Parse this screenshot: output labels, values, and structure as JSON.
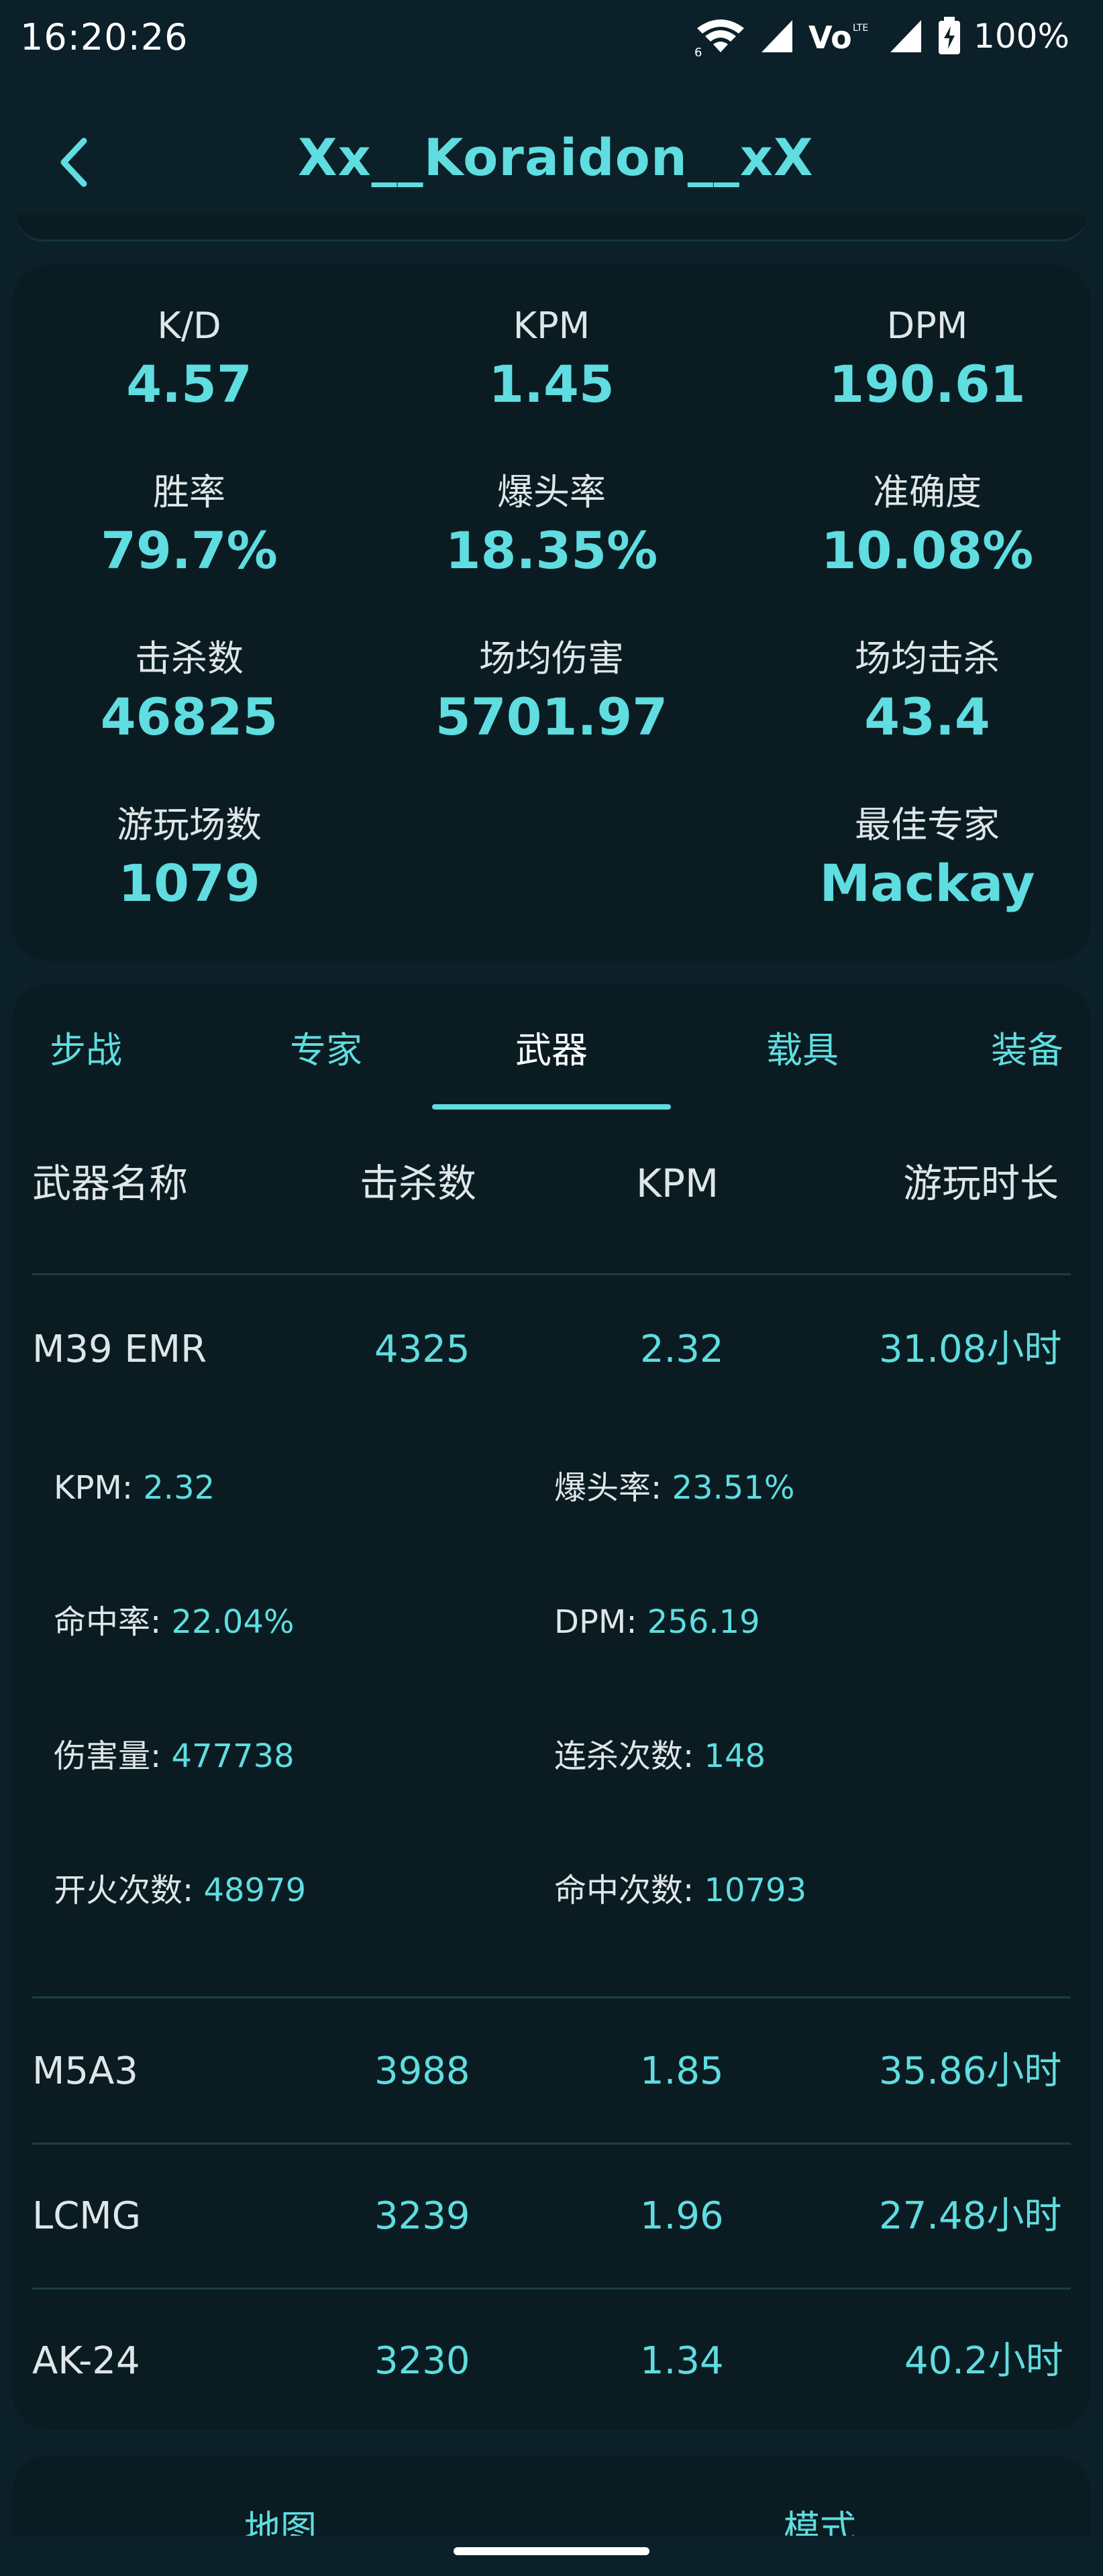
{
  "status_bar": {
    "time": "16:20:26",
    "battery": "100%",
    "icons": [
      "wifi-icon",
      "signal-icon",
      "volte-icon",
      "signal-icon",
      "battery-charging-icon"
    ],
    "network_sub": "6",
    "volte_label": "Vo",
    "lte_label": "LTE"
  },
  "header": {
    "title": "Xx__Koraidon__xX",
    "back_icon": "chevron-left-icon"
  },
  "summary": {
    "stats": [
      {
        "label": "K/D",
        "value": "4.57"
      },
      {
        "label": "KPM",
        "value": "1.45"
      },
      {
        "label": "DPM",
        "value": "190.61"
      },
      {
        "label": "胜率",
        "value": "79.7%"
      },
      {
        "label": "爆头率",
        "value": "18.35%"
      },
      {
        "label": "准确度",
        "value": "10.08%"
      },
      {
        "label": "击杀数",
        "value": "46825"
      },
      {
        "label": "场均伤害",
        "value": "5701.97"
      },
      {
        "label": "场均击杀",
        "value": "43.4"
      },
      {
        "label": "游玩场数",
        "value": "1079"
      },
      {
        "label": "最佳专家",
        "value": "Mackay"
      }
    ]
  },
  "tabs": {
    "items": [
      {
        "label": "步战"
      },
      {
        "label": "专家"
      },
      {
        "label": "武器"
      },
      {
        "label": "载具"
      },
      {
        "label": "装备"
      }
    ],
    "active": "武器"
  },
  "weapons_table": {
    "columns": [
      "武器名称",
      "击杀数",
      "KPM",
      "游玩时长"
    ],
    "rows": [
      {
        "name": "M39 EMR",
        "kills": "4325",
        "kpm": "2.32",
        "time": "31.08小时"
      },
      {
        "name": "M5A3",
        "kills": "3988",
        "kpm": "1.85",
        "time": "35.86小时"
      },
      {
        "name": "LCMG",
        "kills": "3239",
        "kpm": "1.96",
        "time": "27.48小时"
      },
      {
        "name": "AK-24",
        "kills": "3230",
        "kpm": "1.34",
        "time": "40.2小时"
      }
    ],
    "expanded_details": [
      {
        "label": "KPM: ",
        "value": "2.32"
      },
      {
        "label": "爆头率: ",
        "value": "23.51%"
      },
      {
        "label": "命中率: ",
        "value": "22.04%"
      },
      {
        "label": "DPM: ",
        "value": "256.19"
      },
      {
        "label": "伤害量: ",
        "value": "477738"
      },
      {
        "label": "连杀次数: ",
        "value": "148"
      },
      {
        "label": "开火次数: ",
        "value": "48979"
      },
      {
        "label": "命中次数: ",
        "value": "10793"
      }
    ]
  },
  "bottom_tabs": {
    "items": [
      {
        "label": "地图"
      },
      {
        "label": "模式"
      }
    ]
  },
  "colors": {
    "background": "#0b2028",
    "card": "#0a1c22",
    "accent": "#5fdde0",
    "text": "#dfe6e8"
  }
}
